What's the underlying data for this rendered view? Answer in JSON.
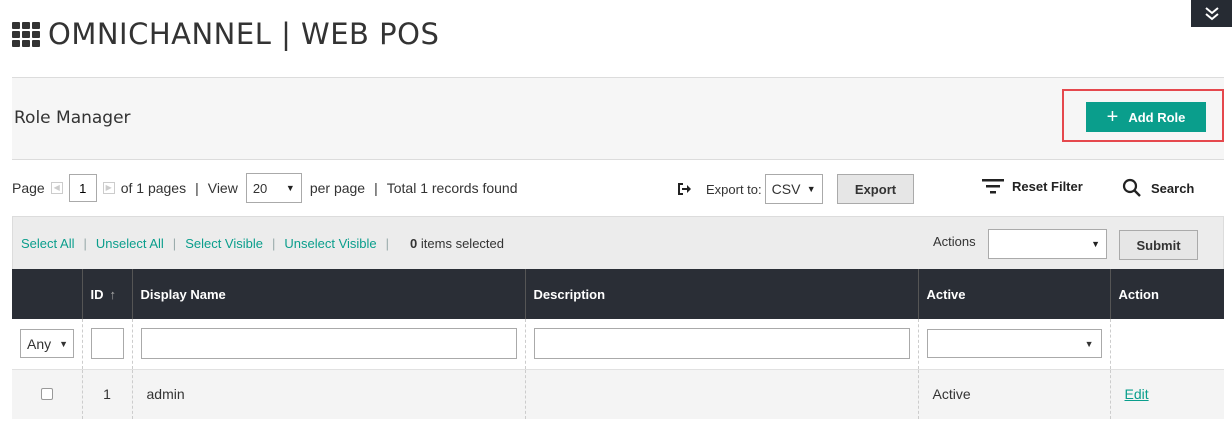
{
  "header": {
    "app_title": "OMNICHANNEL | WEB POS",
    "toggle_icon": "double-chevron-down-icon"
  },
  "page": {
    "title": "Role Manager",
    "add_button_label": "Add Role"
  },
  "pager": {
    "page_label": "Page",
    "current_page": "1",
    "of_pages": "of 1 pages",
    "view_label": "View",
    "per_page_value": "20",
    "per_page_label": "per page",
    "total_text": "Total 1 records found"
  },
  "export": {
    "label": "Export to:",
    "format": "CSV",
    "button_label": "Export"
  },
  "toolbar": {
    "reset_filter_label": "Reset Filter",
    "search_label": "Search"
  },
  "massaction": {
    "select_all": "Select All",
    "unselect_all": "Unselect All",
    "select_visible": "Select Visible",
    "unselect_visible": "Unselect Visible",
    "selected_count": "0",
    "selected_suffix": "items selected",
    "actions_label": "Actions",
    "actions_value": "",
    "submit_label": "Submit"
  },
  "table": {
    "columns": [
      "",
      "ID",
      "Display Name",
      "Description",
      "Active",
      "Action"
    ],
    "filters": {
      "massaction_value": "Any",
      "id": "",
      "display_name": "",
      "description": "",
      "active": ""
    },
    "rows": [
      {
        "id": "1",
        "display_name": "admin",
        "description": "",
        "active": "Active",
        "action": "Edit"
      }
    ]
  },
  "colors": {
    "accent": "#0a9e8c",
    "header_bg": "#2a2e36",
    "highlight": "#e5484d"
  }
}
